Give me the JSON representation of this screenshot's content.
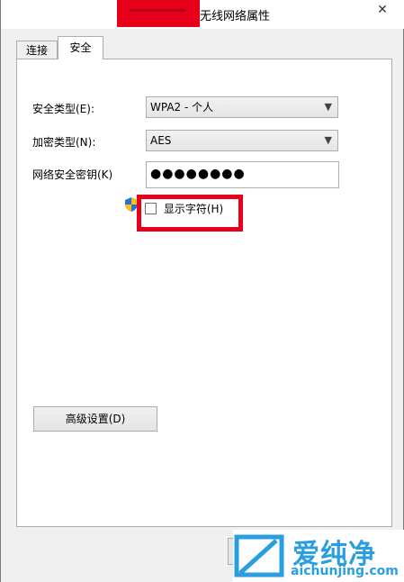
{
  "window": {
    "title": "无线网络属性",
    "close_glyph": "✕"
  },
  "tabs": [
    {
      "label": "连接"
    },
    {
      "label": "安全"
    }
  ],
  "security": {
    "security_type_label": "安全类型(E):",
    "security_type_value": "WPA2 - 个人",
    "encryption_type_label": "加密类型(N):",
    "encryption_type_value": "AES",
    "network_key_label": "网络安全密钥(K)",
    "network_key_value": "●●●●●●●●",
    "show_chars_label": "显示字符(H)"
  },
  "buttons": {
    "advanced_label": "高级设置(D)"
  },
  "watermark": {
    "brand": "爱纯净",
    "url": "aichunjing.com"
  },
  "colors": {
    "highlight_red": "#e8001a",
    "watermark_blue": "#2a9fe0"
  },
  "icons": {
    "shield": "uac-shield-icon",
    "dropdown": "chevron-down-icon",
    "close": "close-icon"
  }
}
